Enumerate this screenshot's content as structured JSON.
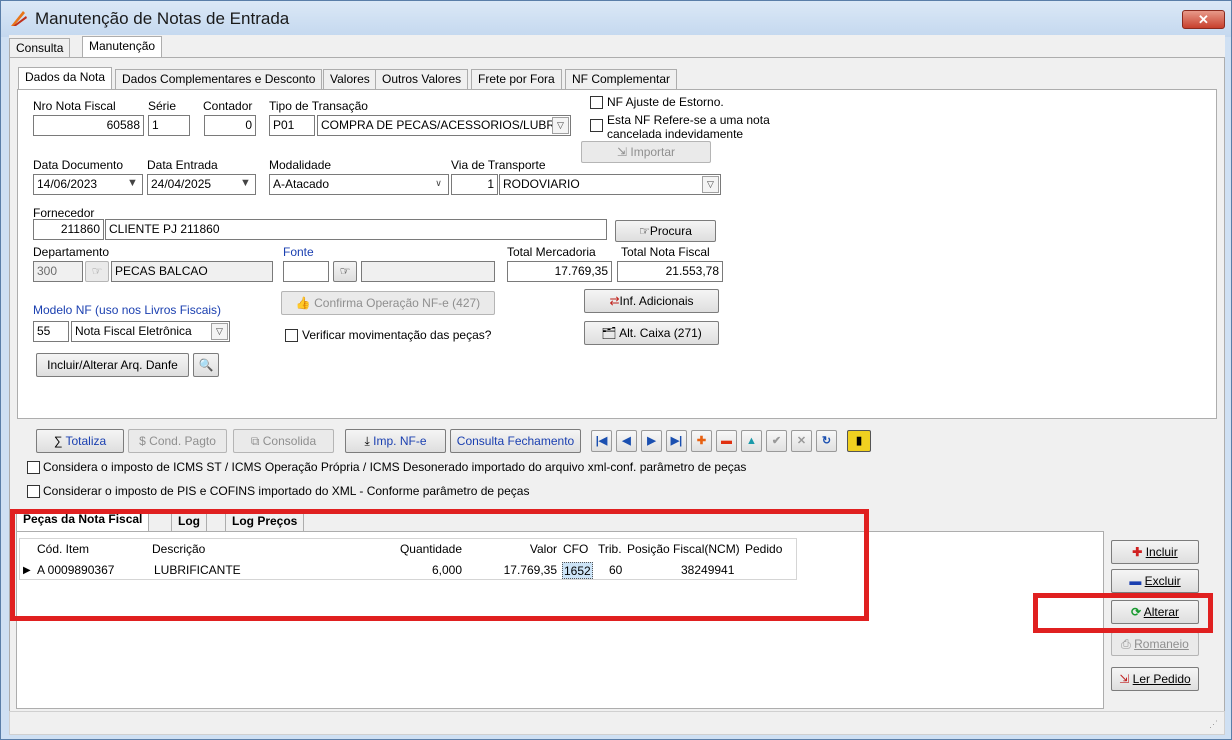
{
  "window": {
    "title": "Manutenção de Notas de Entrada",
    "close": "✕"
  },
  "top_tabs": [
    "Consulta",
    "Manutenção"
  ],
  "sub_tabs": [
    "Dados da Nota",
    "Dados Complementares e Desconto",
    "Valores",
    "Outros Valores",
    "Frete por Fora",
    "NF Complementar"
  ],
  "form": {
    "nro_label": "Nro Nota Fiscal",
    "nro": "60588",
    "serie_label": "Série",
    "serie": "1",
    "contador_label": "Contador",
    "contador": "0",
    "tipo_label": "Tipo de Transação",
    "tipo_code": "P01",
    "tipo_desc": "COMPRA DE PECAS/ACESSORIOS/LUBRI",
    "ajuste_label": "NF Ajuste  de Estorno.",
    "refere_label_1": "Esta NF Refere-se a uma nota",
    "refere_label_2": "cancelada indevidamente",
    "importar": "Importar",
    "data_doc_label": "Data Documento",
    "data_doc": "14/06/2023",
    "data_ent_label": "Data Entrada",
    "data_ent": "24/04/2025",
    "modalidade_label": "Modalidade",
    "modalidade": "A-Atacado",
    "via_label": "Via de Transporte",
    "via_code": "1",
    "via_desc": "RODOVIARIO",
    "fornecedor_label": "Fornecedor",
    "fornecedor_code": "211860",
    "fornecedor_nome": "CLIENTE PJ 211860",
    "procura": "Procura",
    "depto_label": "Departamento",
    "depto_code": "300",
    "depto_nome": "PECAS BALCAO",
    "fonte_label": "Fonte",
    "total_merc_label": "Total Mercadoria",
    "total_merc": "17.769,35",
    "total_nf_label": "Total Nota Fiscal",
    "total_nf": "21.553,78",
    "inf_adic": "Inf. Adicionais",
    "modelo_label": "Modelo NF (uso nos Livros Fiscais)",
    "modelo_code": "55",
    "modelo_desc": "Nota Fiscal Eletrônica",
    "confirma": "Confirma Operação NF-e (427)",
    "verificar_label": "Verificar movimentação das peças?",
    "alt_caixa": "Alt. Caixa (271)",
    "danfe": "Incluir/Alterar Arq. Danfe"
  },
  "toolbar": {
    "totaliza": "Totaliza",
    "cond_pagto": "Cond. Pagto",
    "consolida": "Consolida",
    "imp_nfe": "Imp. NF-e",
    "consulta_fech": "Consulta Fechamento"
  },
  "checks": {
    "icms": "Considera o imposto de ICMS ST / ICMS Operação Própria / ICMS Desonerado importado do arquivo xml-conf. parâmetro de peças",
    "pis": "Considerar o imposto de PIS e COFINS importado do XML - Conforme parâmetro de peças"
  },
  "grid_tabs": [
    "Peças da Nota Fiscal",
    "Log",
    "Log Preços"
  ],
  "grid": {
    "headers": [
      "Cód. Item",
      "Descrição",
      "Quantidade",
      "Valor",
      "CFO",
      "Trib.",
      "Posição Fiscal(NCM)",
      "Pedido"
    ],
    "rows": [
      [
        "A  0009890367",
        "LUBRIFICANTE",
        "6,000",
        "17.769,35",
        "1652",
        "60",
        "38249941",
        ""
      ]
    ]
  },
  "side_buttons": {
    "incluir": "Incluir",
    "excluir": "Excluir",
    "alterar": "Alterar",
    "romaneio": "Romaneio",
    "ler_pedido": "Ler Pedido"
  },
  "colors": {
    "accent_red": "#e02020",
    "link_blue": "#1a3fb0"
  }
}
